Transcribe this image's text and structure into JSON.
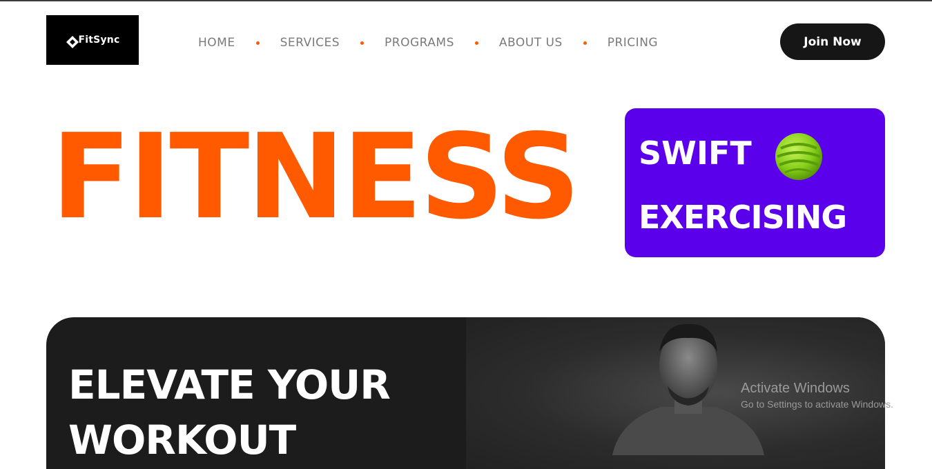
{
  "brand": {
    "name": "FitSync",
    "logo_icon": "diamond-logo-icon"
  },
  "nav": {
    "items": [
      {
        "label": "HOME"
      },
      {
        "label": "SERVICES"
      },
      {
        "label": "PROGRAMS"
      },
      {
        "label": "ABOUT US"
      },
      {
        "label": "PRICING"
      }
    ]
  },
  "cta": {
    "join_label": "Join Now"
  },
  "hero": {
    "title": "FITNESS",
    "promo_line1": "SWIFT",
    "promo_line2": "EXERCISING",
    "promo_icon": "green-ball-icon"
  },
  "banner": {
    "title_line1": "ELEVATE YOUR",
    "title_line2": "WORKOUT"
  },
  "system": {
    "activate_title": "Activate Windows",
    "activate_subtitle": "Go to Settings to activate Windows."
  },
  "colors": {
    "accent": "#ff5a00",
    "promo_bg": "#5b00ea",
    "dark": "#161616",
    "ball_green": "#8fd61a"
  }
}
